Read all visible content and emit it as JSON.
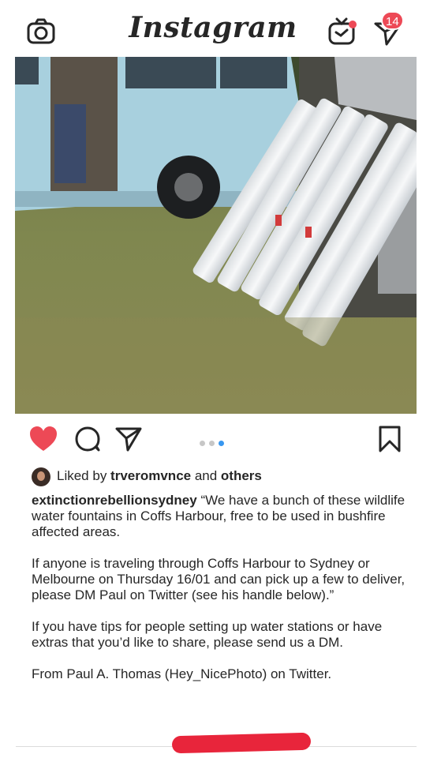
{
  "app": {
    "title": "Instagram"
  },
  "header": {
    "notification_count": "14"
  },
  "icons": {
    "camera": "camera-icon",
    "igtv": "igtv-icon",
    "direct": "direct-message-icon",
    "like": "heart-icon",
    "comment": "comment-icon",
    "share": "share-icon",
    "save": "bookmark-icon"
  },
  "colors": {
    "like_red": "#ed4956",
    "active_dot": "#3897f0",
    "badge": "#ed4956",
    "redaction": "#e8253b"
  },
  "post": {
    "carousel": {
      "count": 3,
      "active_index": 2
    },
    "likes": {
      "prefix": "Liked by ",
      "user": "trveromvnce",
      "middle": " and ",
      "suffix": "others"
    },
    "caption": {
      "username": "extinctionrebellionsydney",
      "p1": " “We have a bunch of these wildlife water fountains in Coffs Harbour, free to be used in bushfire affected  areas.",
      "p2": "If anyone is traveling through Coffs Harbour to Sydney or Melbourne on Thursday 16/01 and can pick up a few to deliver, please DM Paul on Twitter (see his handle below).”",
      "p3": "If you have tips for people setting up water stations or have extras that you’d like to share, please send us a DM.",
      "p4": "From Paul A. Thomas (Hey_NicePhoto) on Twitter."
    }
  }
}
